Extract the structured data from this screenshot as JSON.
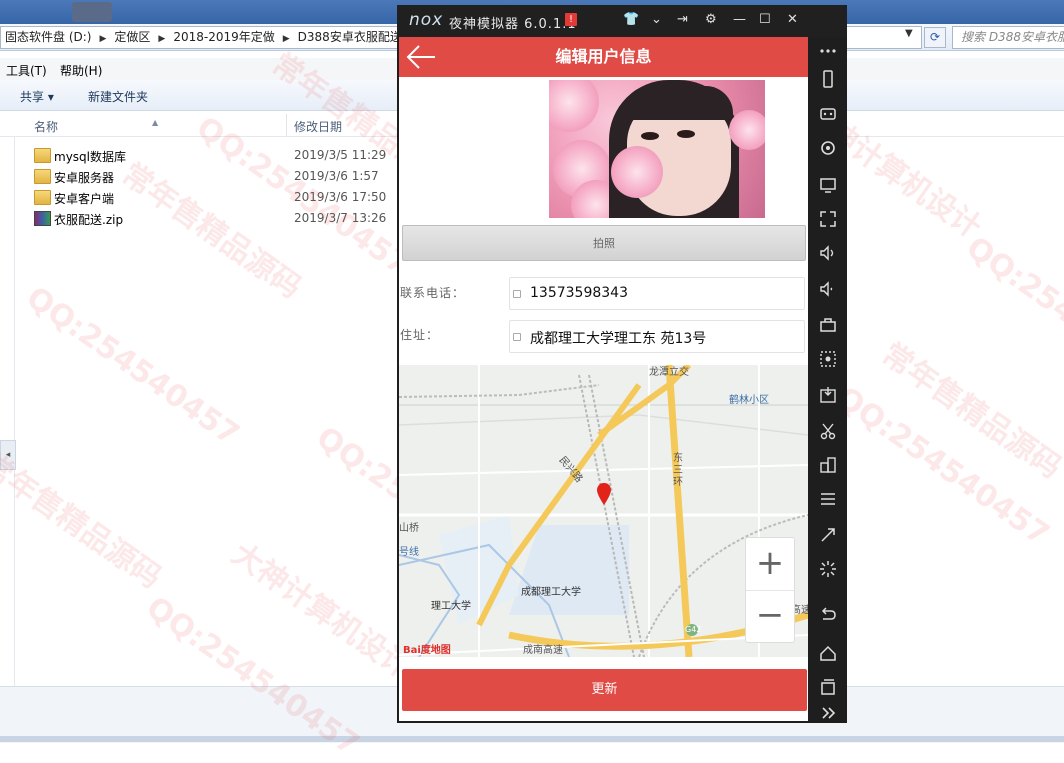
{
  "explorer": {
    "address_crumbs": [
      "固态软件盘 (D:)",
      "定做区",
      "2018-2019年定做",
      "D388安卓衣服配送"
    ],
    "search_placeholder": "搜索 D388安卓衣服配",
    "menu": [
      "工具(T)",
      "帮助(H)"
    ],
    "toolbar": {
      "share_label": "共享 ▾",
      "new_folder_label": "新建文件夹"
    },
    "columns": {
      "name": "名称",
      "modified": "修改日期"
    },
    "files": [
      {
        "name": "mysql数据库",
        "date": "2019/3/5 11:29",
        "type": "folder"
      },
      {
        "name": "安卓服务器",
        "date": "2019/3/6 1:57",
        "type": "folder"
      },
      {
        "name": "安卓客户端",
        "date": "2019/3/6 17:50",
        "type": "folder"
      },
      {
        "name": "衣服配送.zip",
        "date": "2019/3/7 13:26",
        "type": "zip"
      }
    ]
  },
  "emulator": {
    "logo": "nox",
    "title": "夜神模拟器 6.0.1.1",
    "alert_badge": "!"
  },
  "app": {
    "header_title": "编辑用户信息",
    "photo_button": "拍照",
    "phone_label": "联系电话：",
    "phone_value": "13573598343",
    "address_label": "住址：",
    "address_value": "成都理工大学理工东  苑13号",
    "update_button": "更新",
    "accent_color": "#e04b46"
  },
  "map": {
    "labels": {
      "longtan": "龙潭立交",
      "helin": "鹤林小区",
      "minxing": "民兴路",
      "dongsan": "东三环",
      "shanqiao": "山桥",
      "line": "号线",
      "ligong_univ": "理工大学",
      "chengdu_ligong": "成都理工大学",
      "chengnan": "成南高速",
      "gaosu": "高速",
      "g42": "G42",
      "baidu": "Bai度地图"
    },
    "zoom_in": "+",
    "zoom_out": "−"
  },
  "watermarks": [
    "QQ:254540457",
    "常年售精品源码",
    "大神计算机设计"
  ]
}
